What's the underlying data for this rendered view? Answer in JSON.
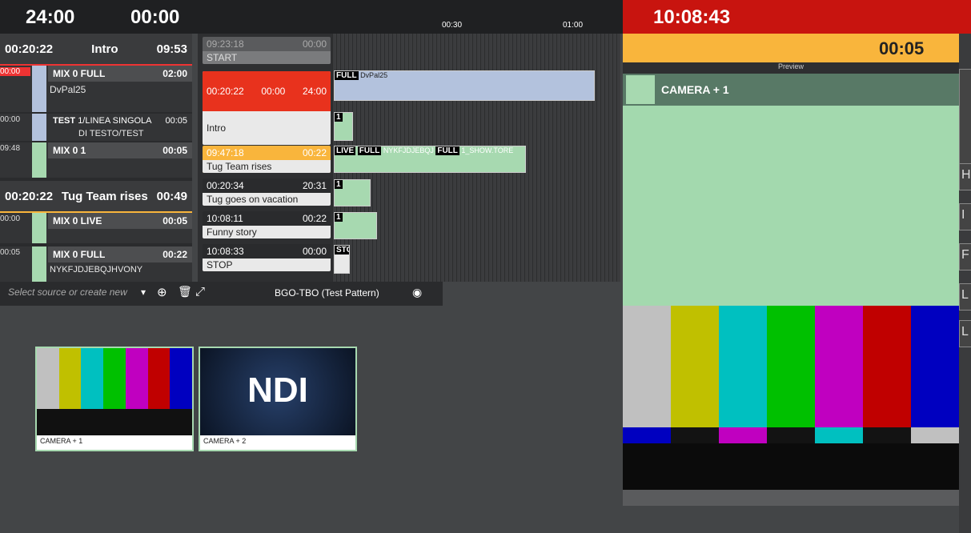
{
  "header": {
    "time_left": "24:00",
    "time_right": "00:00",
    "ruler_ticks": [
      "00:30",
      "01:00"
    ],
    "clock": "10:08:43",
    "countdown": "00:05"
  },
  "segments": [
    {
      "start": "00:20:22",
      "title": "Intro",
      "duration": "09:53"
    },
    {
      "start": "00:20:22",
      "title": "Tug Team rises",
      "duration": "00:49"
    }
  ],
  "left_items": [
    {
      "tc": "00:00",
      "name": "MIX 0 FULL",
      "dur": "02:00",
      "sub": "DvPal25"
    },
    {
      "tc": "00:00",
      "name": "TEST",
      "text": "1/LINEA SINGOLA",
      "dur": "00:05",
      "sub": "DI TESTO/TEST"
    },
    {
      "tc": "09:48",
      "name": "MIX 0 1",
      "dur": "00:05",
      "sub": ""
    },
    {
      "tc": "00:00",
      "name": "MIX 0 LIVE",
      "dur": "00:05",
      "sub": ""
    },
    {
      "tc": "00:05",
      "name": "MIX 0 FULL",
      "dur": "00:22",
      "sub": "NYKFJDJEBQJHVONY"
    }
  ],
  "rundown": [
    {
      "time": "09:23:18",
      "dur": "00:00",
      "title": "START"
    },
    {
      "time": "00:20:22",
      "mid": "00:00",
      "dur": "24:00",
      "title": "Intro"
    },
    {
      "time": "09:47:18",
      "dur": "00:22",
      "title": "Tug Team rises"
    },
    {
      "time": "00:20:34",
      "dur": "20:31",
      "title": "Tug goes on vacation"
    },
    {
      "time": "10:08:11",
      "dur": "00:22",
      "title": "Funny story"
    },
    {
      "time": "10:08:33",
      "dur": "00:00",
      "title": "STOP"
    }
  ],
  "timeline": {
    "full_tag": "FULL",
    "clip_name": "DvPal25",
    "live_tag": "LIVE",
    "mid_clip": "NYKFJDJEBQJ",
    "show_clip": "1_SHOW.TORE",
    "one": "1",
    "stop_tag": "STOP",
    "fuli": "FULL"
  },
  "toolbar": {
    "source_placeholder": "Select source or create new",
    "pattern": "BGO-TBO (Test Pattern)"
  },
  "thumbnails": [
    {
      "label": "CAMERA + 1"
    },
    {
      "label": "CAMERA + 2",
      "logo": "NDI"
    }
  ],
  "preview": {
    "label": "Preview",
    "source": "CAMERA + 1"
  },
  "side_buttons": [
    "H",
    "I",
    "F",
    "L",
    "L"
  ],
  "colors": {
    "accent_green": "#a7d9b0",
    "red": "#c8140f",
    "orange": "#f9b53c"
  }
}
